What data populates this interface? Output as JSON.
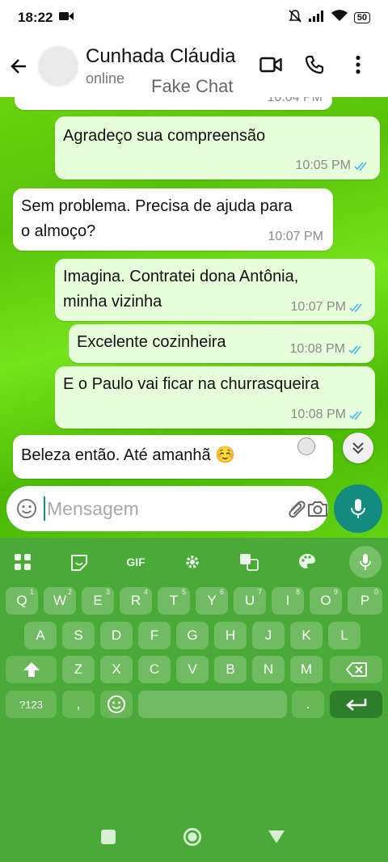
{
  "status_bar": {
    "time": "18:22",
    "battery": "50"
  },
  "header": {
    "contact_name": "Cunhada Cláudia",
    "contact_status": "online",
    "watermark": "Fake Chat"
  },
  "messages": [
    {
      "direction": "in",
      "text": "",
      "time": "10:04 PM",
      "partial": true
    },
    {
      "direction": "out",
      "text": "Agradeço sua compreensão",
      "time": "10:05 PM",
      "read": true
    },
    {
      "direction": "in",
      "line1": "Sem problema. Precisa de ajuda para",
      "line2": "o almoço?",
      "time": "10:07 PM"
    },
    {
      "direction": "out",
      "line1": "Imagina. Contratei dona Antônia,",
      "line2": "minha vizinha",
      "time": "10:07 PM",
      "read": true
    },
    {
      "direction": "out",
      "text": "Excelente cozinheira",
      "time": "10:08 PM",
      "read": true
    },
    {
      "direction": "out",
      "text": "E o Paulo vai ficar na churrasqueira",
      "time": "10:08 PM",
      "read": true
    },
    {
      "direction": "in",
      "text": "Beleza então. Até amanhã ☺️",
      "time": ""
    }
  ],
  "composer": {
    "placeholder": "Mensagem"
  },
  "keyboard": {
    "toolbar": [
      "apps-icon",
      "sticker-icon",
      "GIF",
      "settings-icon",
      "translate-icon",
      "palette-icon",
      "mic-icon"
    ],
    "gif_label": "GIF",
    "row1": [
      "Q",
      "W",
      "E",
      "R",
      "T",
      "Y",
      "U",
      "I",
      "O",
      "P"
    ],
    "row1_hints": [
      "1",
      "2",
      "3",
      "4",
      "5",
      "6",
      "7",
      "8",
      "9",
      "0"
    ],
    "row2": [
      "A",
      "S",
      "D",
      "F",
      "G",
      "H",
      "J",
      "K",
      "L"
    ],
    "row3": [
      "Z",
      "X",
      "C",
      "V",
      "B",
      "N",
      "M"
    ],
    "symbols_label": "?123",
    "comma": ",",
    "period": "."
  },
  "colors": {
    "accent": "#128c7e",
    "outgoing_bubble": "#e7ffdb",
    "read_ticks": "#53bdeb",
    "keyboard_bg": "#4aaa37"
  }
}
